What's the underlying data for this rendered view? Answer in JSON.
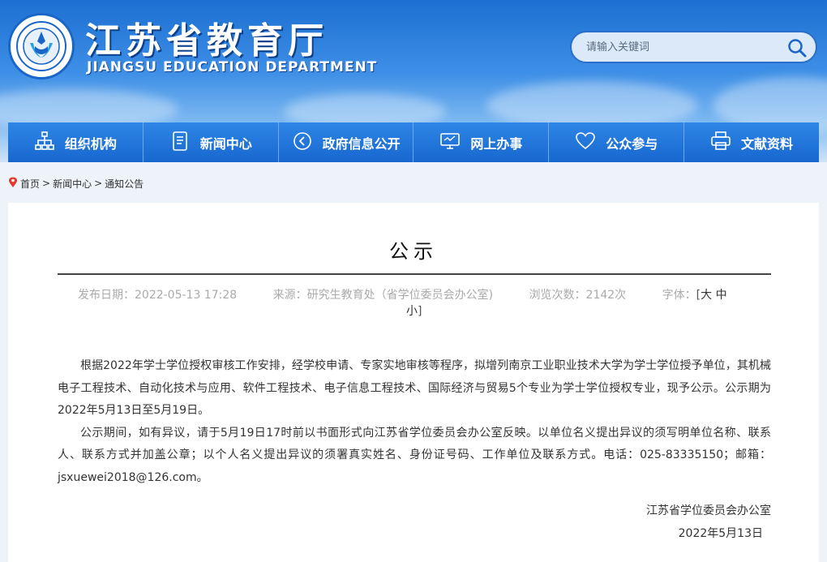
{
  "header": {
    "title": "江苏省教育厅",
    "subtitle": "JIANGSU EDUCATION DEPARTMENT",
    "logo_icon": "dept-emblem-icon",
    "colors": {
      "brand": "#1a66c8",
      "nav": "#1767cf"
    }
  },
  "search": {
    "placeholder": "请输入关键词",
    "icon": "search-icon"
  },
  "nav": {
    "items": [
      {
        "label": "组织机构",
        "icon": "org-chart-icon"
      },
      {
        "label": "新闻中心",
        "icon": "document-icon"
      },
      {
        "label": "政府信息公开",
        "icon": "play-circle-icon"
      },
      {
        "label": "网上办事",
        "icon": "monitor-icon"
      },
      {
        "label": "公众参与",
        "icon": "heart-icon"
      },
      {
        "label": "文献资料",
        "icon": "printer-icon"
      }
    ]
  },
  "breadcrumb": {
    "home": "首页",
    "sep1": ">",
    "section": "新闻中心",
    "sep2": ">",
    "current": "通知公告"
  },
  "article": {
    "title": "公示",
    "meta": {
      "date_label": "发布日期：",
      "date": "2022-05-13 17:28",
      "source_label": "来源：",
      "source": "研究生教育处（省学位委员会办公室)",
      "views_label": "浏览次数：",
      "views": "2142次",
      "font_label": "字体：",
      "bracket_open": "[",
      "font_large": "大",
      "font_medium": "中",
      "font_small": "小",
      "bracket_close": "]"
    },
    "paragraphs": [
      "根据2022年学士学位授权审核工作安排，经学校申请、专家实地审核等程序，拟增列南京工业职业技术大学为学士学位授予单位，其机械电子工程技术、自动化技术与应用、软件工程技术、电子信息工程技术、国际经济与贸易5个专业为学士学位授权专业，现予公示。公示期为2022年5月13日至5月19日。",
      "公示期间，如有异议，请于5月19日17时前以书面形式向江苏省学位委员会办公室反映。以单位名义提出异议的须写明单位名称、联系人、联系方式并加盖公章；以个人名义提出异议的须署真实姓名、身份证号码、工作单位及联系方式。电话：025-83335150；邮箱：jsxuewei2018@126.com。"
    ],
    "signature": "江苏省学位委员会办公室",
    "sign_date": "2022年5月13日"
  }
}
